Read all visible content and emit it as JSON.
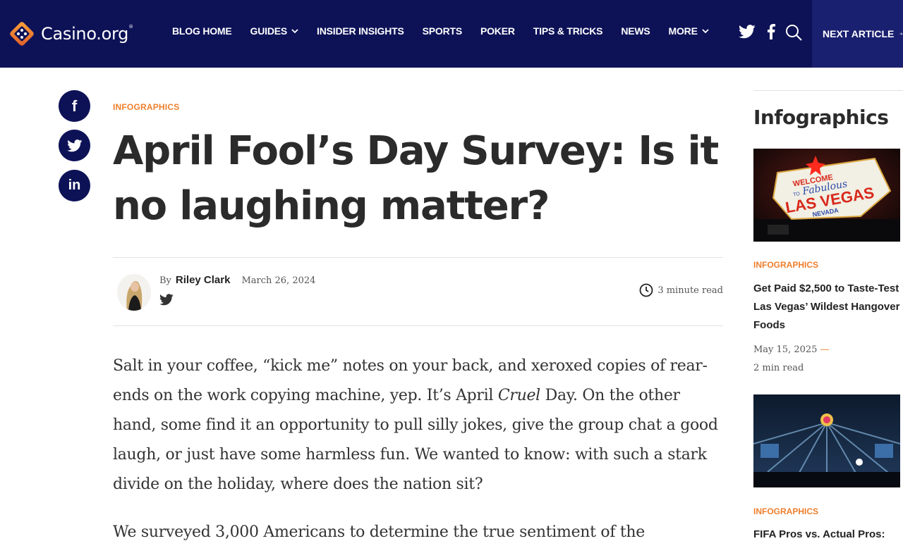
{
  "header": {
    "logo_text": "Casino.org",
    "logo_reg": "®",
    "nav": [
      {
        "label": "BLOG HOME",
        "dropdown": false
      },
      {
        "label": "GUIDES",
        "dropdown": true
      },
      {
        "label": "INSIDER INSIGHTS",
        "dropdown": false
      },
      {
        "label": "SPORTS",
        "dropdown": false
      },
      {
        "label": "POKER",
        "dropdown": false
      },
      {
        "label": "TIPS & TRICKS",
        "dropdown": false
      },
      {
        "label": "NEWS",
        "dropdown": false
      },
      {
        "label": "MORE",
        "dropdown": true
      }
    ],
    "icons": [
      "twitter-icon",
      "facebook-icon",
      "search-icon"
    ],
    "next_article": "NEXT ARTICLE",
    "colors": {
      "header_bg": "#0d1257",
      "accent": "#ee7f2d"
    }
  },
  "share": {
    "items": [
      {
        "icon": "facebook-icon",
        "glyph": "f"
      },
      {
        "icon": "twitter-icon",
        "glyph": ""
      },
      {
        "icon": "linkedin-icon",
        "glyph": "in"
      }
    ]
  },
  "article": {
    "category": "INFOGRAPHICS",
    "title": "April Fool’s Day Survey: Is it no laughing matter?",
    "by": "By",
    "author": "Riley Clark",
    "date": "March 26, 2024",
    "read_time": "3 minute read",
    "para1_a": "Salt in your coffee, “kick me” notes on your back, and xeroxed copies of rear-ends on the work copying machine, yep. It’s April ",
    "para1_em": "Cruel",
    "para1_b": " Day. On the other hand, some find it an opportunity to pull silly jokes, give the group chat a good laugh, or just have some harmless fun. We wanted to know: with such a stark divide on the holiday, where does the nation sit?",
    "para2": "We surveyed 3,000 Americans to determine the true sentiment of the"
  },
  "sidebar": {
    "heading": "Infographics",
    "cards": [
      {
        "category": "INFOGRAPHICS",
        "title": "Get Paid $2,500 to Taste-Test Las Vegas’ Wildest Hangover Foods",
        "date": "May 15, 2025",
        "dash": "—",
        "read_time": "2 min read",
        "image_sign": {
          "welcome": "WELCOME",
          "to": "TO",
          "fabulous": "Fabulous",
          "city": "LAS VEGAS",
          "state": "NEVADA"
        }
      },
      {
        "category": "INFOGRAPHICS",
        "title": "FIFA Pros vs. Actual Pros:"
      }
    ]
  }
}
